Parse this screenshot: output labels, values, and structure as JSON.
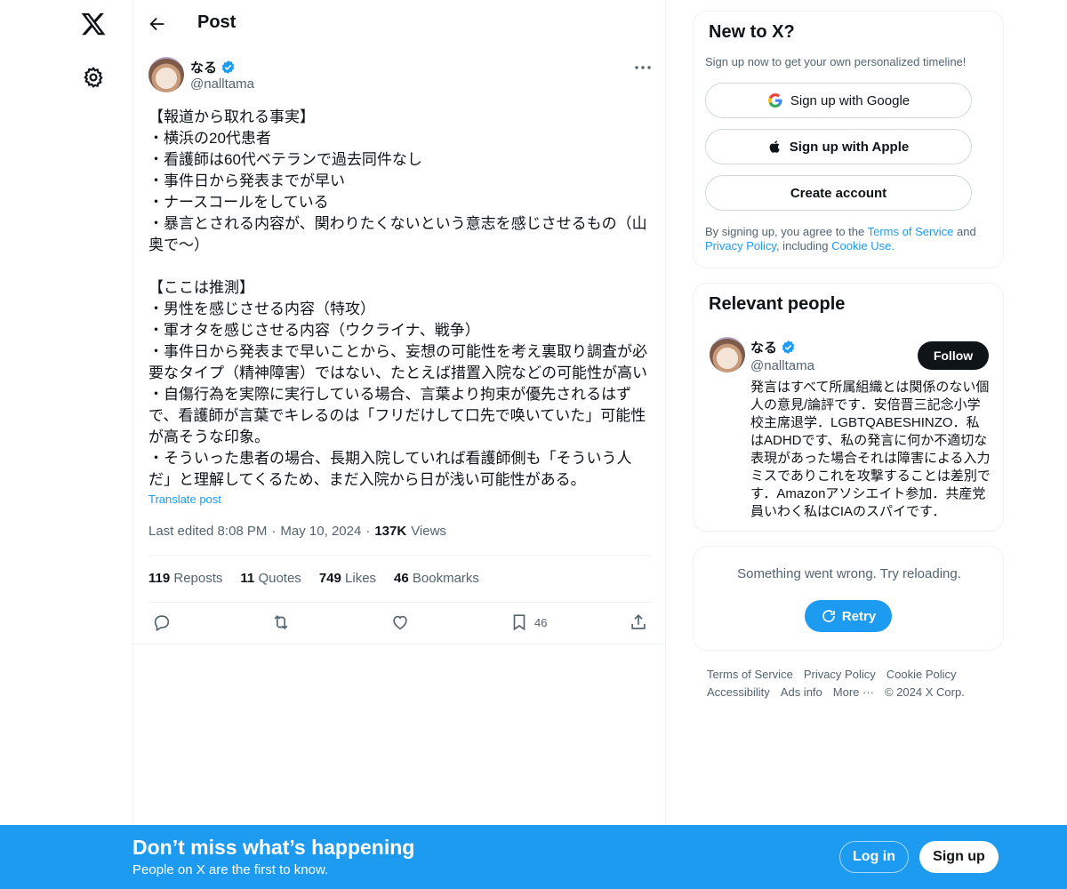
{
  "header": {
    "title": "Post"
  },
  "post": {
    "author": {
      "name": "なる",
      "handle": "@nalltama",
      "verified": true
    },
    "text": "【報道から取れる事実】\n・横浜の20代患者\n・看護師は60代ベテランで過去同件なし\n・事件日から発表までが早い\n・ナースコールをしている\n・暴言とされる内容が、関わりたくないという意志を感じさせるもの（山奥で〜）\n\n【ここは推測】\n・男性を感じさせる内容（特攻）\n・軍オタを感じさせる内容（ウクライナ、戦争）\n・事件日から発表まで早いことから、妄想の可能性を考え裏取り調査が必要なタイプ（精神障害）ではない、たとえば措置入院などの可能性が高い\n・自傷行為を実際に実行している場合、言葉より拘束が優先されるはずで、看護師が言葉でキレるのは「フリだけして口先で唤いていた」可能性が高そうな印象。\n・そういった患者の場合、長期入院していれば看護師側も「そういう人だ」と理解してくるため、まだ入院から日が浅い可能性がある。",
    "translate_label": "Translate post",
    "edited": "Last edited 8:08 PM",
    "date": "May 10, 2024",
    "views_count": "137K",
    "views_label": "Views",
    "stats": {
      "reposts": {
        "count": "119",
        "label": "Reposts"
      },
      "quotes": {
        "count": "11",
        "label": "Quotes"
      },
      "likes": {
        "count": "749",
        "label": "Likes"
      },
      "bookmarks": {
        "count": "46",
        "label": "Bookmarks"
      }
    },
    "bookmark_action_count": "46"
  },
  "signup_card": {
    "title": "New to X?",
    "subtitle": "Sign up now to get your own personalized timeline!",
    "google": "Sign up with Google",
    "apple": "Sign up with Apple",
    "create": "Create account",
    "legal_prefix": "By signing up, you agree to the ",
    "terms": "Terms of Service",
    "and": " and ",
    "privacy": "Privacy Policy",
    "including": ", including ",
    "cookie": "Cookie Use."
  },
  "relevant": {
    "title": "Relevant people",
    "name": "なる",
    "handle": "@nalltama",
    "follow": "Follow",
    "bio": "発言はすべて所属組織とは関係のない個人の意見/論評です．安倍晋三記念小学校主席退学．LGBTQABESHINZO．私はADHDです、私の発言に何か不適切な表現があった場合それは障害による入力ミスでありこれを攻撃することは差別です．Amazonアソシエイト参加．共産党員いわく私はCIAのスパイです．"
  },
  "error_card": {
    "message": "Something went wrong. Try reloading.",
    "retry": "Retry"
  },
  "footer": {
    "terms": "Terms of Service",
    "privacy": "Privacy Policy",
    "cookie": "Cookie Policy",
    "accessibility": "Accessibility",
    "ads": "Ads info",
    "more": "More ···",
    "copyright": "© 2024 X Corp."
  },
  "banner": {
    "title": "Don’t miss what’s happening",
    "subtitle": "People on X are the first to know.",
    "login": "Log in",
    "signup": "Sign up"
  },
  "colors": {
    "accent": "#1d9bf0",
    "text": "#0f1419",
    "muted": "#536471",
    "border": "#eff3f4"
  }
}
